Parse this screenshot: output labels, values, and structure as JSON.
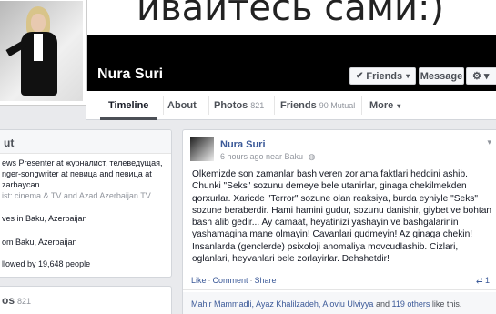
{
  "cover": {
    "text": "ивайтесь сами:)"
  },
  "profile": {
    "name": "Nura Suri"
  },
  "buttons": {
    "friends": "Friends",
    "message": "Message",
    "gear": "⚙ ▾"
  },
  "tabs": {
    "timeline": "Timeline",
    "about": "About",
    "photos": "Photos",
    "photos_count": "821",
    "friends": "Friends",
    "friends_count": "90 Mutual",
    "more": "More"
  },
  "about": {
    "header": "ut",
    "rows": [
      "ews Presenter at журналист, телеведущая,",
      "nger-songwriter at певица and певица at",
      "zarbaycan",
      "ist: cinema & TV and Azad Azerbaijan TV",
      "ves in Baku, Azerbaijan",
      "om Baku, Azerbaijan",
      "llowed by 19,648 people"
    ],
    "photos_header": "os",
    "photos_count": "821"
  },
  "post": {
    "author": "Nura Suri",
    "time": "6 hours ago near Baku",
    "text": "Olkemizde son zamanlar bash veren zorlama faktlari heddini ashib. Chunki \"Seks\" sozunu demeye bele utanirlar, ginaga chekilmekden qorxurlar. Xaricde \"Terror\" sozune olan reaksiya, burda eyniyle \"Seks\" sozune beraberdir. Hami hamini gudur, sozunu danishir, giybet ve bohtan bash alib gedir... Ay camaat, heyatinizi yashayin ve bashgalarinin yashamagina mane olmayin! Cavanlari gudmeyin! Az ginaga chekin! Insanlarda (genclerde) psixoloji anomaliya movcudlashib. Cizlari, oglanlari, heyvanlari bele zorlayirlar. Dehshetdir!",
    "actions": {
      "like": "Like",
      "comment": "Comment",
      "share": "Share"
    },
    "share_count": "1",
    "likes": {
      "names": "Mahir Mammadli, Ayaz Khalilzadeh, Aloviu Ulviyya",
      "and": "and",
      "others": "119 others",
      "suffix": "like this."
    }
  }
}
